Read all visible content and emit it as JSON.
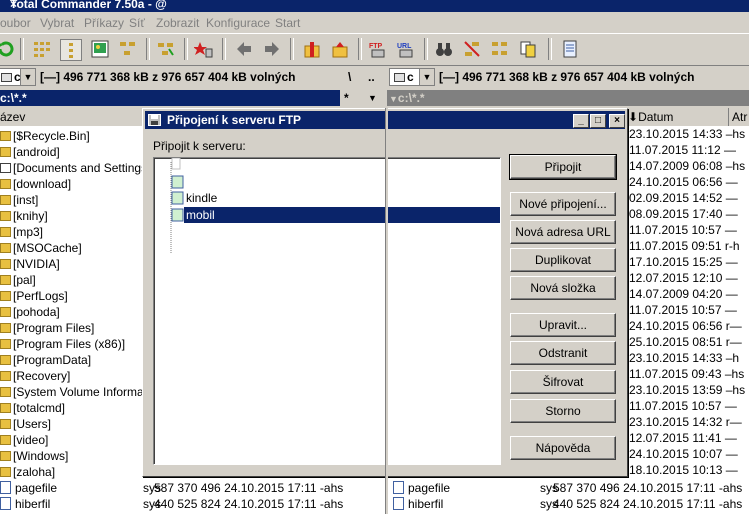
{
  "app": {
    "title": "Total Commander 7.50a - @",
    "close": "×"
  },
  "menu": [
    "oubor",
    "Vybrat",
    "Příkazy",
    "Síť",
    "Zobrazit",
    "Konfigurace",
    "Start"
  ],
  "left": {
    "drive": "c",
    "free": "[—]  496 771 368 kB z 976 657 404 kB volných",
    "root_btn": "\\",
    "up_btn": "..",
    "path": "c:\\*.*",
    "path_star": "*",
    "col_name": "ázev",
    "folders": [
      "[$Recycle.Bin]",
      "[android]",
      "[Documents and Settings]",
      "[download]",
      "[inst]",
      "[knihy]",
      "[mp3]",
      "[MSOCache]",
      "[NVIDIA]",
      "[pal]",
      "[PerfLogs]",
      "[pohoda]",
      "[Program Files]",
      "[Program Files (x86)]",
      "[ProgramData]",
      "[Recovery]",
      "[System Volume Information]",
      "[totalcmd]",
      "[Users]",
      "[video]",
      "[Windows]",
      "[zaloha]"
    ],
    "files": [
      {
        "name": "pagefile",
        "ext": "sys",
        "info": "587 370 496 24.10.2015 17:11 -ahs"
      },
      {
        "name": "hiberfil",
        "ext": "sys",
        "info": "440 525 824 24.10.2015 17:11 -ahs"
      }
    ]
  },
  "right": {
    "drive": "c",
    "free": "[—]  496 771 368 kB z 976 657 404 kB volných",
    "path": "c:\\*.*",
    "path_star": "*",
    "col_date": "Datum",
    "col_attr": "Atr",
    "sort_arrow": "⬇",
    "dates": [
      "23.10.2015 14:33 –hs",
      "11.07.2015 11:12 —",
      "14.07.2009 06:08 –hs",
      "24.10.2015 06:56 —",
      "02.09.2015 14:52 —",
      "08.09.2015 17:40 —",
      "11.07.2015 10:57 —",
      "11.07.2015 09:51 r-h",
      "17.10.2015 15:25 —",
      "12.07.2015 12:10 —",
      "14.07.2009 04:20 —",
      "11.07.2015 10:57 —",
      "24.10.2015 06:56 r—",
      "25.10.2015 08:51 r—",
      "23.10.2015 14:33 –h",
      "11.07.2015 09:43 –hs",
      "23.10.2015 13:59 –hs",
      "11.07.2015 10:57 —",
      "23.10.2015 14:32 r—",
      "12.07.2015 11:41 —",
      "24.10.2015 10:07 —",
      "18.10.2015 10:13 —"
    ],
    "files": [
      {
        "name": "pagefile",
        "ext": "sys",
        "info": "587 370 496 24.10.2015 17:11 -ahs"
      },
      {
        "name": "hiberfil",
        "ext": "sys",
        "info": "440 525 824 24.10.2015 17:11 -ahs"
      }
    ]
  },
  "dialog": {
    "title": "Připojení k serveru FTP",
    "label": "Připojit k serveru:",
    "tree": [
      "kindle",
      "mobil"
    ],
    "buttons": {
      "connect": "Připojit",
      "new_connection": "Nové připojení...",
      "new_url": "Nová adresa URL",
      "duplicate": "Duplikovat",
      "new_folder": "Nová složka",
      "edit": "Upravit...",
      "delete": "Odstranit",
      "encrypt": "Šifrovat",
      "cancel": "Storno",
      "help": "Nápověda"
    }
  },
  "colors": {
    "selection": "#0a246a",
    "face": "#d4d0c8"
  }
}
